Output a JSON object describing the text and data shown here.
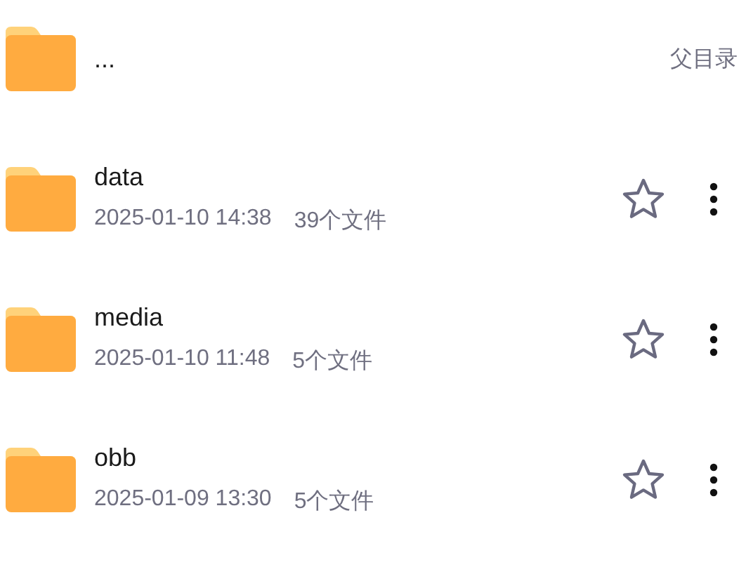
{
  "parent": {
    "name": "...",
    "label": "父目录"
  },
  "folders": [
    {
      "name": "data",
      "date": "2025-01-10 14:38",
      "count": "39个文件",
      "favorite": false
    },
    {
      "name": "media",
      "date": "2025-01-10 11:48",
      "count": "5个文件",
      "favorite": false
    },
    {
      "name": "obb",
      "date": "2025-01-09 13:30",
      "count": "5个文件",
      "favorite": false
    }
  ]
}
